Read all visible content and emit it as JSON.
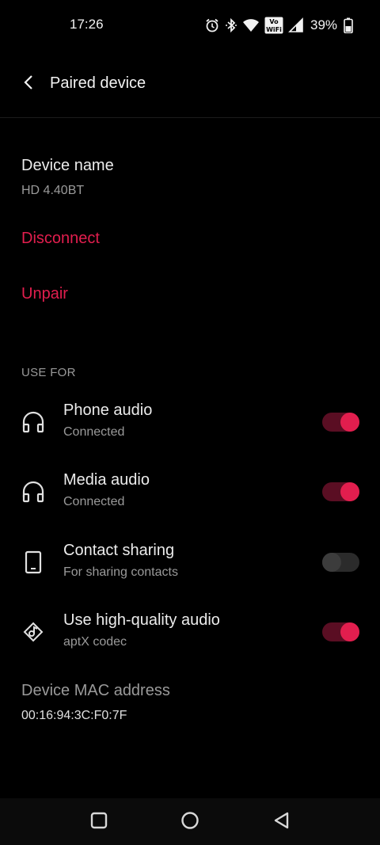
{
  "status_bar": {
    "time": "17:26",
    "battery_percent": "39%",
    "icons": [
      "alarm-icon",
      "bluetooth-icon",
      "wifi-icon",
      "vowifi-icon",
      "cell-signal-icon",
      "battery-icon"
    ]
  },
  "header": {
    "title": "Paired device",
    "back_icon": "back-arrow-icon"
  },
  "device": {
    "name_label": "Device name",
    "name_value": "HD 4.40BT",
    "disconnect_label": "Disconnect",
    "unpair_label": "Unpair"
  },
  "use_for": {
    "section_label": "USE FOR",
    "items": [
      {
        "title": "Phone audio",
        "subtitle": "Connected",
        "icon": "headphones-icon",
        "enabled": true
      },
      {
        "title": "Media audio",
        "subtitle": "Connected",
        "icon": "headphones-icon",
        "enabled": true
      },
      {
        "title": "Contact sharing",
        "subtitle": "For sharing contacts",
        "icon": "phone-device-icon",
        "enabled": false
      },
      {
        "title": "Use high-quality audio",
        "subtitle": "aptX codec",
        "icon": "hq-audio-icon",
        "enabled": true
      }
    ]
  },
  "mac": {
    "label": "Device MAC address",
    "value": "00:16:94:3C:F0:7F"
  },
  "colors": {
    "accent": "#e21e4e",
    "background": "#000000",
    "toggle_on_track": "#5a0e23",
    "toggle_off_track": "#2b2b2b"
  },
  "navbar": {
    "icons": [
      "recents-square-icon",
      "home-circle-icon",
      "back-triangle-icon"
    ]
  }
}
